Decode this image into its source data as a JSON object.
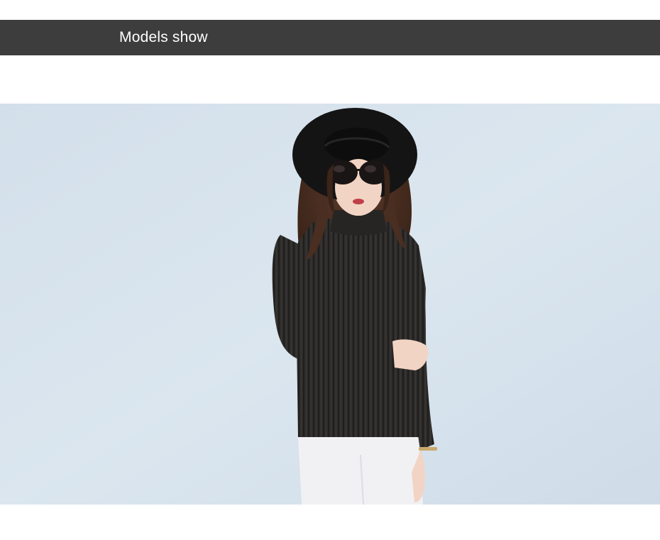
{
  "banner": {
    "title": "Models show"
  },
  "photo": {
    "subject": "model-photo",
    "colors": {
      "wall": "#d6e2ec",
      "sweater": "#2f2d2b",
      "hat": "#141414",
      "pants": "#f1f1f4",
      "hair": "#4a2e22",
      "skin": "#f2d4c4"
    }
  },
  "colors": {
    "banner_bg": "#3d3d3d",
    "banner_text": "#ffffff",
    "page_bg": "#ffffff"
  }
}
